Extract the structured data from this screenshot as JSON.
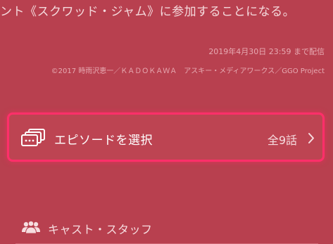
{
  "synopsis": {
    "text": "ント《スクワッド・ジャム》に参加することになる。"
  },
  "availability": {
    "deadline": "2019年4月30日 23:59 まで配信"
  },
  "copyright": {
    "text": "©2017 時雨沢恵一／ＫＡＤＯＫＡＷＡ　アスキー・メディアワークス／GGO Project"
  },
  "episode_selector": {
    "label": "エピソードを選択",
    "count": "全9話",
    "icon": "episodes-stack-icon"
  },
  "cast_staff": {
    "label": "キャスト・スタッフ",
    "icon": "people-icon"
  },
  "colors": {
    "background": "#b8404f",
    "highlight_border": "#ff2f6a"
  }
}
